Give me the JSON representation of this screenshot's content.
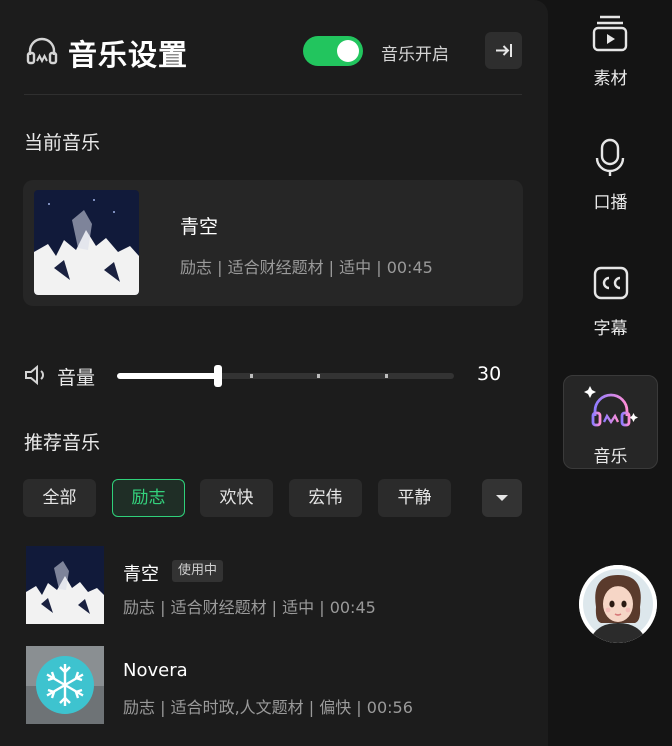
{
  "header": {
    "title": "音乐设置",
    "toggle_on": true,
    "toggle_label": "音乐开启",
    "accent_color": "#22c55e"
  },
  "current": {
    "section_label": "当前音乐",
    "title": "青空",
    "meta": "励志 | 适合财经题材 | 适中 | 00:45"
  },
  "volume": {
    "label": "音量",
    "value": "30",
    "level_fraction": 0.3
  },
  "recommend": {
    "section_label": "推荐音乐",
    "filters": [
      "全部",
      "励志",
      "欢快",
      "宏伟",
      "平静"
    ],
    "active_filter": "励志",
    "items": [
      {
        "title": "青空",
        "badge": "使用中",
        "meta": "励志 | 适合财经题材 | 适中 | 00:45"
      },
      {
        "title": "Novera",
        "badge": "",
        "meta": "励志 | 适合时政,人文题材 | 偏快 | 00:56"
      }
    ]
  },
  "rail": {
    "items": [
      {
        "label": "素材",
        "icon": "media-icon"
      },
      {
        "label": "口播",
        "icon": "microphone-icon"
      },
      {
        "label": "字幕",
        "icon": "cc-icon"
      },
      {
        "label": "音乐",
        "icon": "music-headphone-icon",
        "selected": true
      }
    ]
  }
}
